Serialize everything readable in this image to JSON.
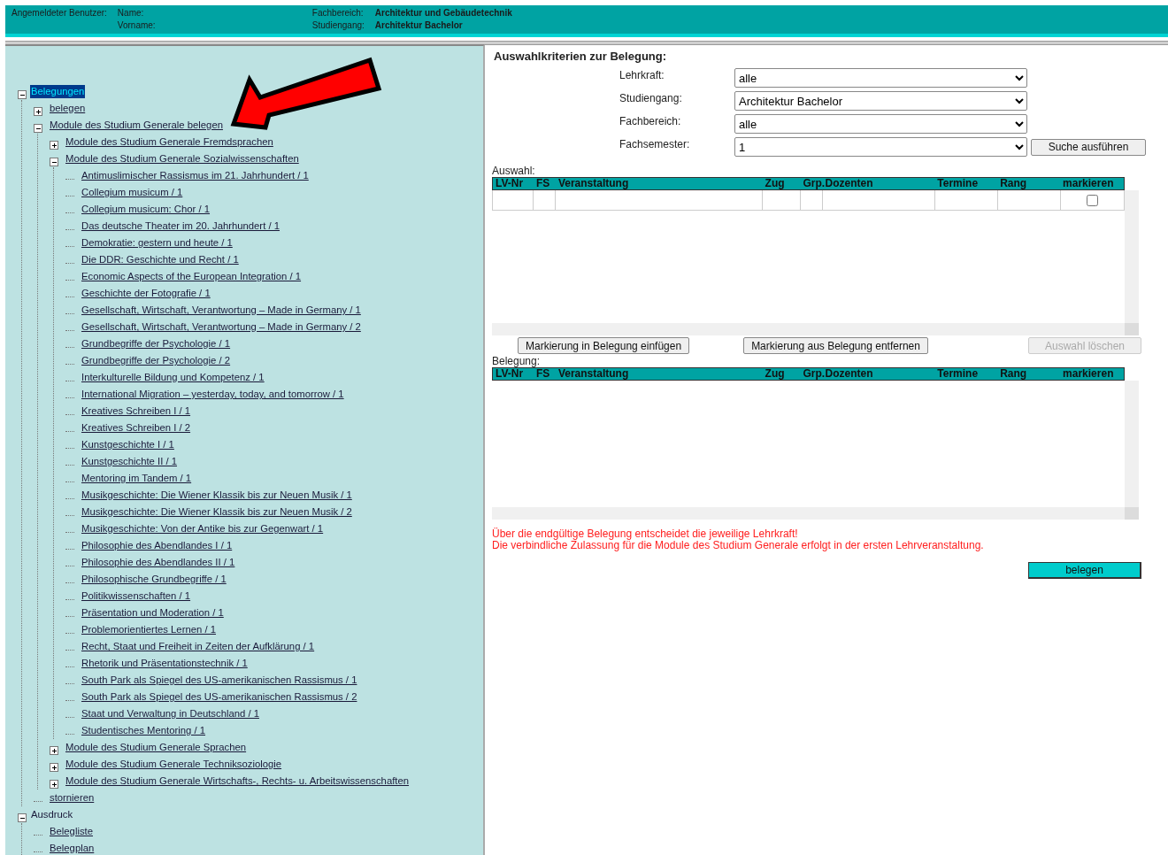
{
  "header": {
    "user_label": "Angemeldeter Benutzer:",
    "left_fields": [
      {
        "label": "Name:"
      },
      {
        "label": "Vorname:"
      }
    ],
    "right_fields": [
      {
        "label": "Fachbereich:",
        "value": "Architektur und Gebäudetechnik"
      },
      {
        "label": "Studiengang:",
        "value": "Architektur Bachelor"
      }
    ]
  },
  "tree": [
    {
      "label": "Belegungen",
      "selected": true,
      "expanded": true,
      "children": [
        {
          "label": "belegen",
          "selected": false,
          "expanded": false
        },
        {
          "label": "Module des Studium Generale belegen",
          "selected": false,
          "expanded": true,
          "children": [
            {
              "label": "Module des Studium Generale Fremdsprachen",
              "selected": false,
              "expanded": false
            },
            {
              "label": "Module des Studium Generale Sozialwissenschaften",
              "selected": false,
              "expanded": true,
              "children": [
                {
                  "label": "Antimuslimischer Rassismus im 21. Jahrhundert / 1",
                  "selected": false
                },
                {
                  "label": "Collegium musicum / 1",
                  "selected": false
                },
                {
                  "label": "Collegium musicum: Chor / 1",
                  "selected": false
                },
                {
                  "label": "Das deutsche Theater im 20. Jahrhundert / 1",
                  "selected": false
                },
                {
                  "label": "Demokratie: gestern und heute / 1",
                  "selected": false
                },
                {
                  "label": "Die DDR: Geschichte und Recht / 1",
                  "selected": false
                },
                {
                  "label": "Economic Aspects of the European Integration / 1",
                  "selected": false
                },
                {
                  "label": "Geschichte der Fotografie / 1",
                  "selected": false
                },
                {
                  "label": "Gesellschaft, Wirtschaft, Verantwortung – Made in Germany / 1",
                  "selected": false
                },
                {
                  "label": "Gesellschaft, Wirtschaft, Verantwortung – Made in Germany / 2",
                  "selected": false
                },
                {
                  "label": "Grundbegriffe der Psychologie / 1",
                  "selected": false
                },
                {
                  "label": "Grundbegriffe der Psychologie / 2",
                  "selected": false
                },
                {
                  "label": "Interkulturelle Bildung und Kompetenz / 1",
                  "selected": false
                },
                {
                  "label": "International Migration – yesterday, today, and tomorrow / 1",
                  "selected": false
                },
                {
                  "label": "Kreatives Schreiben I / 1",
                  "selected": false
                },
                {
                  "label": "Kreatives Schreiben I / 2",
                  "selected": false
                },
                {
                  "label": "Kunstgeschichte I / 1",
                  "selected": false
                },
                {
                  "label": "Kunstgeschichte II / 1",
                  "selected": false
                },
                {
                  "label": "Mentoring im Tandem / 1",
                  "selected": false
                },
                {
                  "label": "Musikgeschichte: Die Wiener Klassik bis zur Neuen Musik / 1",
                  "selected": false
                },
                {
                  "label": "Musikgeschichte: Die Wiener Klassik bis zur Neuen Musik / 2",
                  "selected": false
                },
                {
                  "label": "Musikgeschichte: Von der Antike bis zur Gegenwart / 1",
                  "selected": false
                },
                {
                  "label": "Philosophie des Abendlandes I / 1",
                  "selected": false
                },
                {
                  "label": "Philosophie des Abendlandes II / 1",
                  "selected": false
                },
                {
                  "label": "Philosophische Grundbegriffe / 1",
                  "selected": false
                },
                {
                  "label": "Politikwissenschaften / 1",
                  "selected": false
                },
                {
                  "label": "Präsentation und Moderation / 1",
                  "selected": false
                },
                {
                  "label": "Problemorientiertes Lernen / 1",
                  "selected": false
                },
                {
                  "label": "Recht, Staat und Freiheit in Zeiten der Aufklärung / 1",
                  "selected": false
                },
                {
                  "label": "Rhetorik und Präsentationstechnik / 1",
                  "selected": false
                },
                {
                  "label": "South Park als Spiegel des US-amerikanischen Rassismus / 1",
                  "selected": false
                },
                {
                  "label": "South Park als Spiegel des US-amerikanischen Rassismus / 2",
                  "selected": false
                },
                {
                  "label": "Staat und Verwaltung in Deutschland / 1",
                  "selected": false
                },
                {
                  "label": "Studentisches Mentoring / 1",
                  "selected": false
                }
              ]
            },
            {
              "label": "Module des Studium Generale Sprachen",
              "selected": false,
              "expanded": false
            },
            {
              "label": "Module des Studium Generale Techniksoziologie",
              "selected": false,
              "expanded": false
            },
            {
              "label": "Module des Studium Generale Wirtschafts-, Rechts- u. Arbeitswissenschaften",
              "selected": false,
              "expanded": false
            }
          ]
        },
        {
          "label": "stornieren",
          "selected": false
        }
      ]
    },
    {
      "label": "Ausdruck",
      "selected": false,
      "expanded": true,
      "children": [
        {
          "label": "Belegliste",
          "selected": false
        },
        {
          "label": "Belegplan",
          "selected": false
        }
      ]
    }
  ],
  "criteria": {
    "title": "Auswahlkriterien zur Belegung:",
    "fields": [
      {
        "label": "Lehrkraft:",
        "value": "alle"
      },
      {
        "label": "Studiengang:",
        "value": "Architektur Bachelor"
      },
      {
        "label": "Fachbereich:",
        "value": "alle"
      },
      {
        "label": "Fachsemester:",
        "value": "1"
      }
    ],
    "search_button": "Suche ausführen"
  },
  "selection": {
    "label": "Auswahl:",
    "columns": [
      "LV-Nr",
      "FS",
      "Veranstaltung",
      "Zug",
      "Grp.",
      "Dozenten",
      "Termine",
      "Rang",
      "markieren"
    ],
    "rows": [
      {
        "checked": false
      }
    ]
  },
  "actions": [
    {
      "label": "Markierung in Belegung einfügen",
      "disabled": false
    },
    {
      "label": "Markierung aus Belegung entfernen",
      "disabled": false
    },
    {
      "label": "Auswahl löschen",
      "disabled": true
    }
  ],
  "enrollment": {
    "label": "Belegung:",
    "columns": [
      "LV-Nr",
      "FS",
      "Veranstaltung",
      "Zug",
      "Grp.",
      "Dozenten",
      "Termine",
      "Rang",
      "markieren"
    ]
  },
  "notes": [
    "Über die endgültige Belegung entscheidet die jeweilige Lehrkraft!",
    "Die verbindliche Zulassung für die Module des Studium Generale erfolgt in der ersten Lehrveranstaltung."
  ],
  "submit_button": "belegen",
  "annotation": {
    "kind": "arrow"
  }
}
